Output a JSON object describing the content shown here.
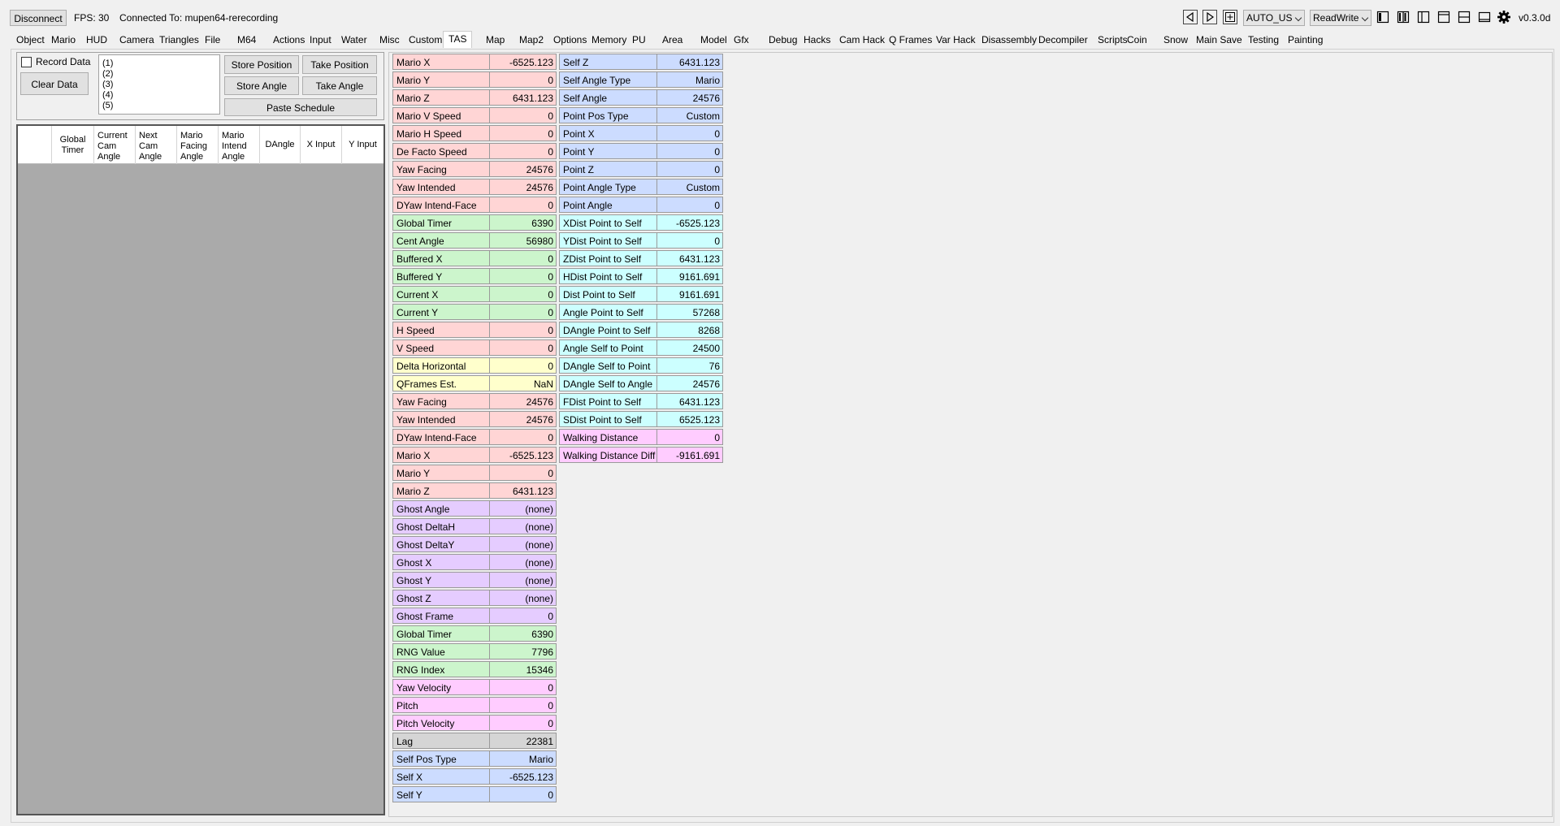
{
  "topbar": {
    "disconnect": "Disconnect",
    "fps": "FPS: 30",
    "connected": "Connected To: mupen64-rerecording",
    "rom_version": "AUTO_US",
    "access_mode": "ReadWrite",
    "version": "v0.3.0d"
  },
  "tabs": [
    "Object",
    "Mario",
    "HUD",
    "Camera",
    "Triangles",
    "File",
    "M64",
    "Actions",
    "Input",
    "Water",
    "Misc",
    "Custom",
    "TAS",
    "Map",
    "Map2",
    "Options",
    "Memory",
    "PU",
    "Area",
    "Model",
    "Gfx",
    "Debug",
    "Hacks",
    "Cam Hack",
    "Q Frames",
    "Var Hack",
    "Disassembly",
    "Decompiler",
    "Scripts",
    "Coin",
    "Snow",
    "Main Save",
    "Testing",
    "Painting"
  ],
  "active_tab": "TAS",
  "tas": {
    "record_data": "Record Data",
    "clear_data": "Clear Data",
    "store_position": "Store Position",
    "take_position": "Take Position",
    "store_angle": "Store Angle",
    "take_angle": "Take Angle",
    "paste_schedule": "Paste Schedule",
    "schedule_list": [
      "(1)",
      "(2)",
      "(3)",
      "(4)",
      "(5)"
    ],
    "table_headers": [
      "Global\nTimer",
      "Current\nCam\nAngle",
      "Next\nCam\nAngle",
      "Mario\nFacing\nAngle",
      "Mario\nIntend\nAngle",
      "DAngle",
      "X Input",
      "Y Input"
    ]
  },
  "vars_col1": [
    {
      "name": "Mario X",
      "value": "-6525.123",
      "color": "r"
    },
    {
      "name": "Mario Y",
      "value": "0",
      "color": "r"
    },
    {
      "name": "Mario Z",
      "value": "6431.123",
      "color": "r"
    },
    {
      "name": "Mario V Speed",
      "value": "0",
      "color": "r"
    },
    {
      "name": "Mario H Speed",
      "value": "0",
      "color": "r"
    },
    {
      "name": "De Facto Speed",
      "value": "0",
      "color": "r"
    },
    {
      "name": "Yaw Facing",
      "value": "24576",
      "color": "r"
    },
    {
      "name": "Yaw Intended",
      "value": "24576",
      "color": "r"
    },
    {
      "name": "DYaw Intend-Face",
      "value": "0",
      "color": "r"
    },
    {
      "name": "Global Timer",
      "value": "6390",
      "color": "g"
    },
    {
      "name": "Cent Angle",
      "value": "56980",
      "color": "g"
    },
    {
      "name": "Buffered X",
      "value": "0",
      "color": "g"
    },
    {
      "name": "Buffered Y",
      "value": "0",
      "color": "g"
    },
    {
      "name": "Current X",
      "value": "0",
      "color": "g"
    },
    {
      "name": "Current Y",
      "value": "0",
      "color": "g"
    },
    {
      "name": "H Speed",
      "value": "0",
      "color": "r"
    },
    {
      "name": "V Speed",
      "value": "0",
      "color": "r"
    },
    {
      "name": "Delta Horizontal",
      "value": "0",
      "color": "y"
    },
    {
      "name": "QFrames Est.",
      "value": "NaN",
      "color": "y"
    },
    {
      "name": "Yaw Facing",
      "value": "24576",
      "color": "r"
    },
    {
      "name": "Yaw Intended",
      "value": "24576",
      "color": "r"
    },
    {
      "name": "DYaw Intend-Face",
      "value": "0",
      "color": "r"
    },
    {
      "name": "Mario X",
      "value": "-6525.123",
      "color": "r"
    },
    {
      "name": "Mario Y",
      "value": "0",
      "color": "r"
    },
    {
      "name": "Mario Z",
      "value": "6431.123",
      "color": "r"
    },
    {
      "name": "Ghost Angle",
      "value": "(none)",
      "color": "p"
    },
    {
      "name": "Ghost DeltaH",
      "value": "(none)",
      "color": "p"
    },
    {
      "name": "Ghost DeltaY",
      "value": "(none)",
      "color": "p"
    },
    {
      "name": "Ghost X",
      "value": "(none)",
      "color": "p"
    },
    {
      "name": "Ghost Y",
      "value": "(none)",
      "color": "p"
    },
    {
      "name": "Ghost Z",
      "value": "(none)",
      "color": "p"
    },
    {
      "name": "Ghost Frame",
      "value": "0",
      "color": "p"
    },
    {
      "name": "Global Timer",
      "value": "6390",
      "color": "g"
    },
    {
      "name": "RNG Value",
      "value": "7796",
      "color": "g"
    },
    {
      "name": "RNG Index",
      "value": "15346",
      "color": "g"
    },
    {
      "name": "Yaw Velocity",
      "value": "0",
      "color": "m"
    },
    {
      "name": "Pitch",
      "value": "0",
      "color": "m"
    },
    {
      "name": "Pitch Velocity",
      "value": "0",
      "color": "m"
    },
    {
      "name": "Lag",
      "value": "22381",
      "color": "gr"
    },
    {
      "name": "Self Pos Type",
      "value": "Mario",
      "color": "b"
    },
    {
      "name": "Self X",
      "value": "-6525.123",
      "color": "b"
    },
    {
      "name": "Self Y",
      "value": "0",
      "color": "b"
    }
  ],
  "vars_col2": [
    {
      "name": "Self Z",
      "value": "6431.123",
      "color": "b"
    },
    {
      "name": "Self Angle Type",
      "value": "Mario",
      "color": "b"
    },
    {
      "name": "Self Angle",
      "value": "24576",
      "color": "b"
    },
    {
      "name": "Point Pos Type",
      "value": "Custom",
      "color": "b"
    },
    {
      "name": "Point X",
      "value": "0",
      "color": "b"
    },
    {
      "name": "Point Y",
      "value": "0",
      "color": "b"
    },
    {
      "name": "Point Z",
      "value": "0",
      "color": "b"
    },
    {
      "name": "Point Angle Type",
      "value": "Custom",
      "color": "b"
    },
    {
      "name": "Point Angle",
      "value": "0",
      "color": "b"
    },
    {
      "name": "XDist Point to Self",
      "value": "-6525.123",
      "color": "c"
    },
    {
      "name": "YDist Point to Self",
      "value": "0",
      "color": "c"
    },
    {
      "name": "ZDist Point to Self",
      "value": "6431.123",
      "color": "c"
    },
    {
      "name": "HDist Point to Self",
      "value": "9161.691",
      "color": "c"
    },
    {
      "name": "Dist Point to Self",
      "value": "9161.691",
      "color": "c"
    },
    {
      "name": "Angle Point to Self",
      "value": "57268",
      "color": "c"
    },
    {
      "name": "DAngle Point to Self",
      "value": "8268",
      "color": "c"
    },
    {
      "name": "Angle Self to Point",
      "value": "24500",
      "color": "c"
    },
    {
      "name": "DAngle Self to Point",
      "value": "76",
      "color": "c"
    },
    {
      "name": "DAngle Self to Angle",
      "value": "24576",
      "color": "c"
    },
    {
      "name": "FDist Point to Self",
      "value": "6431.123",
      "color": "c"
    },
    {
      "name": "SDist Point to Self",
      "value": "6525.123",
      "color": "c"
    },
    {
      "name": "Walking Distance",
      "value": "0",
      "color": "m"
    },
    {
      "name": "Walking Distance Diff",
      "value": "-9161.691",
      "color": "m"
    }
  ]
}
